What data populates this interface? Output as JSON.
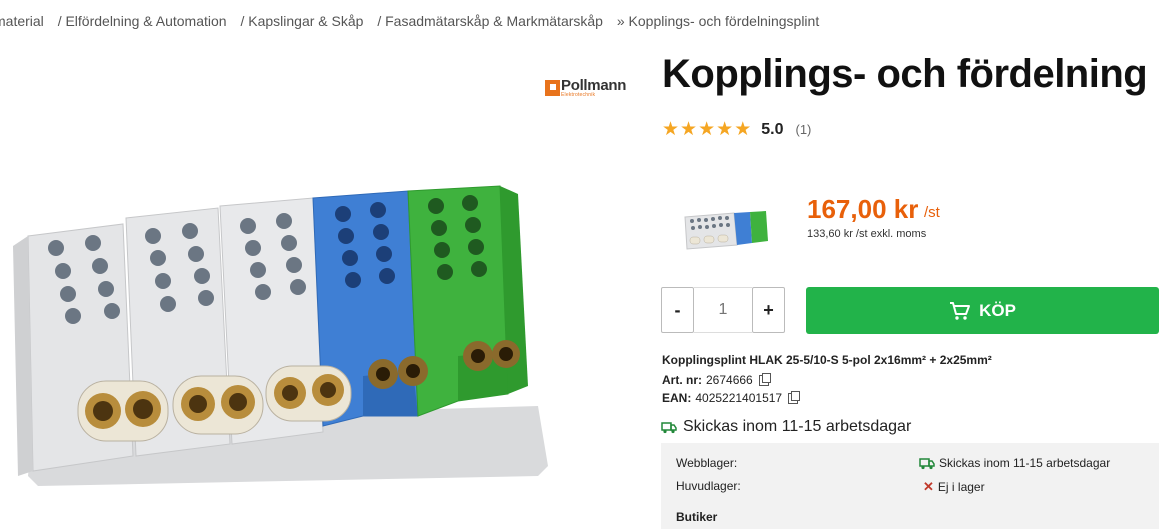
{
  "breadcrumb": [
    "material",
    "/ Elfördelning & Automation",
    "/ Kapslingar & Skåp",
    "/ Fasadmätarskåp & Markmätarskåp",
    "» Kopplings- och fördelningsplint"
  ],
  "brand": {
    "name": "Pollmann",
    "sub": "Elektrotechnik",
    "color": "#e8731c"
  },
  "product": {
    "title": "Kopplings- och fördelning",
    "rating": "5.0",
    "rating_count": "(1)",
    "price": "167,00 kr",
    "price_unit": "/st",
    "price_ex_vat": "133,60 kr /st exkl. moms",
    "description": "Kopplingsplint HLAK 25-5/10-S 5-pol 2x16mm² + 2x25mm²",
    "art_label": "Art. nr:",
    "art_nr": "2674666",
    "ean_label": "EAN:",
    "ean": "4025221401517"
  },
  "purchase": {
    "minus": "-",
    "plus": "+",
    "quantity_placeholder": "1",
    "buy_label": "KÖP"
  },
  "shipping": {
    "main": "Skickas inom 11-15 arbetsdagar",
    "webblager_label": "Webblager:",
    "webblager_status": "Skickas inom 11-15 arbetsdagar",
    "huvudlager_label": "Huvudlager:",
    "huvudlager_status": "Ej i lager",
    "butiker_label": "Butiker"
  },
  "colors": {
    "price": "#e8600a",
    "buy": "#22b34a",
    "star": "#f5a623"
  }
}
